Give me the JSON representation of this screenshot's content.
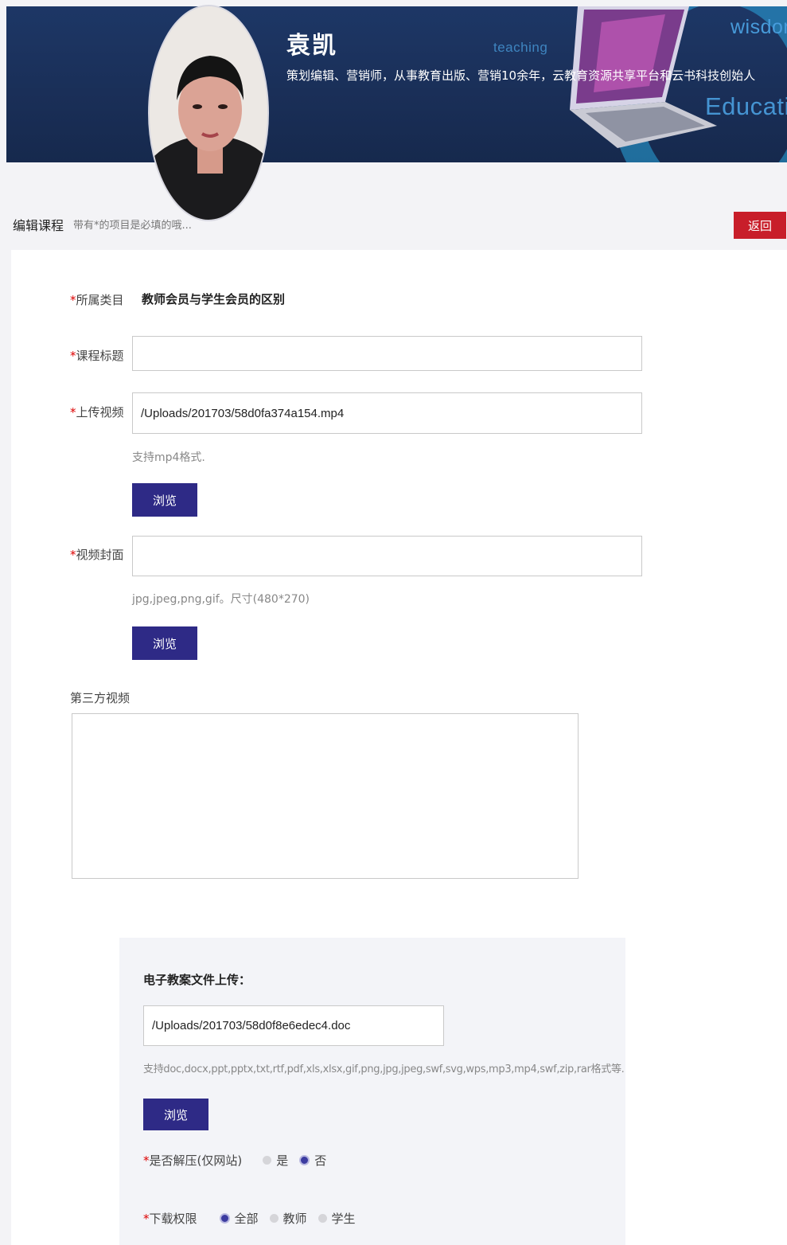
{
  "header": {
    "name": "袁凯",
    "bio": "策划编辑、营销师，从事教育出版、营销10余年，云教育资源共享平台和云书科技创始人",
    "words": {
      "teaching": "teaching",
      "wisdom": "wisdom",
      "education": "Education"
    }
  },
  "subheader": {
    "title": "编辑课程",
    "hint": "带有*的项目是必填的哦...",
    "back_label": "返回"
  },
  "form": {
    "category": {
      "required": "*",
      "label": "所属类目",
      "value": "教师会员与学生会员的区别"
    },
    "course_title": {
      "required": "*",
      "label": "课程标题",
      "value": ""
    },
    "video": {
      "required": "*",
      "label": "上传视频",
      "value": "/Uploads/201703/58d0fa374a154.mp4",
      "hint": "支持mp4格式.",
      "browse_label": "浏览"
    },
    "cover": {
      "required": "*",
      "label": "视频封面",
      "value": "",
      "hint": "jpg,jpeg,png,gif。尺寸(480*270)",
      "browse_label": "浏览"
    },
    "third_party": {
      "label": "第三方视频",
      "value": ""
    }
  },
  "upload": {
    "title": "电子教案文件上传：",
    "value": "/Uploads/201703/58d0f8e6edec4.doc",
    "hint": "支持doc,docx,ppt,pptx,txt,rtf,pdf,xls,xlsx,gif,png,jpg,jpeg,swf,svg,wps,mp3,mp4,swf,zip,rar格式等.",
    "browse_label": "浏览",
    "unzip": {
      "required": "*",
      "label": "是否解压(仅网站)",
      "options": [
        "是",
        "否"
      ],
      "selected": "否"
    },
    "permission": {
      "required": "*",
      "label": "下载权限",
      "options": [
        "全部",
        "教师",
        "学生"
      ],
      "selected": "全部"
    }
  },
  "colors": {
    "banner": "#1d3766",
    "back_button": "#c81e2a",
    "primary_button": "#2e2a86",
    "required": "#dd0000"
  }
}
